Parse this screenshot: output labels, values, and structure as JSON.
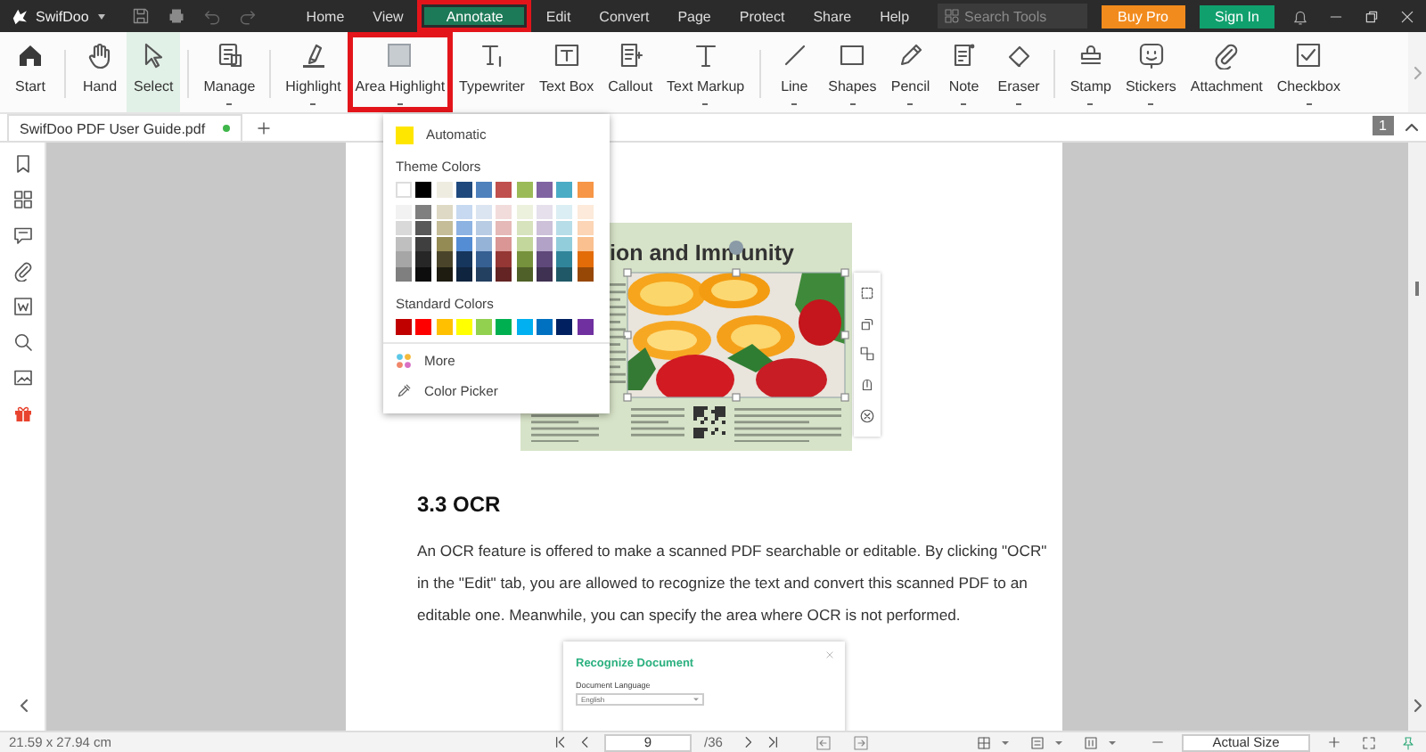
{
  "app": {
    "name": "SwifDoo"
  },
  "menu": [
    {
      "label": "Home",
      "selected": false,
      "marked": false
    },
    {
      "label": "View",
      "selected": false,
      "marked": false
    },
    {
      "label": "Annotate",
      "selected": true,
      "marked": true
    },
    {
      "label": "Edit",
      "selected": false,
      "marked": false
    },
    {
      "label": "Convert",
      "selected": false,
      "marked": false
    },
    {
      "label": "Page",
      "selected": false,
      "marked": false
    },
    {
      "label": "Protect",
      "selected": false,
      "marked": false
    },
    {
      "label": "Share",
      "selected": false,
      "marked": false
    },
    {
      "label": "Help",
      "selected": false,
      "marked": false
    }
  ],
  "search": {
    "placeholder": "Search Tools"
  },
  "account_buttons": [
    {
      "label": "Buy Pro",
      "kind": "purchase"
    },
    {
      "label": "Sign In",
      "kind": "sign_in"
    }
  ],
  "toolbar": {
    "tools": [
      {
        "label": "Start",
        "selected": false,
        "marked": false,
        "dropdown": false,
        "separator_before": false
      },
      {
        "label": "Hand",
        "selected": false,
        "marked": false,
        "dropdown": false,
        "separator_before": true
      },
      {
        "label": "Select",
        "selected": true,
        "marked": false,
        "dropdown": false,
        "separator_before": false
      },
      {
        "label": "Manage",
        "selected": false,
        "marked": false,
        "dropdown": true,
        "separator_before": true
      },
      {
        "label": "Highlight",
        "selected": false,
        "marked": false,
        "dropdown": true,
        "separator_before": true
      },
      {
        "label": "Area Highlight",
        "selected": false,
        "marked": true,
        "dropdown": true,
        "separator_before": false
      },
      {
        "label": "Typewriter",
        "selected": false,
        "marked": false,
        "dropdown": false,
        "separator_before": false
      },
      {
        "label": "Text Box",
        "selected": false,
        "marked": false,
        "dropdown": false,
        "separator_before": false
      },
      {
        "label": "Callout",
        "selected": false,
        "marked": false,
        "dropdown": false,
        "separator_before": false
      },
      {
        "label": "Text Markup",
        "selected": false,
        "marked": false,
        "dropdown": true,
        "separator_before": false
      },
      {
        "label": "Line",
        "selected": false,
        "marked": false,
        "dropdown": true,
        "separator_before": true
      },
      {
        "label": "Shapes",
        "selected": false,
        "marked": false,
        "dropdown": true,
        "separator_before": false
      },
      {
        "label": "Pencil",
        "selected": false,
        "marked": false,
        "dropdown": true,
        "separator_before": false
      },
      {
        "label": "Note",
        "selected": false,
        "marked": false,
        "dropdown": true,
        "separator_before": false
      },
      {
        "label": "Eraser",
        "selected": false,
        "marked": false,
        "dropdown": true,
        "separator_before": false
      },
      {
        "label": "Stamp",
        "selected": false,
        "marked": false,
        "dropdown": true,
        "separator_before": true
      },
      {
        "label": "Stickers",
        "selected": false,
        "marked": false,
        "dropdown": true,
        "separator_before": false
      },
      {
        "label": "Attachment",
        "selected": false,
        "marked": false,
        "dropdown": false,
        "separator_before": false
      },
      {
        "label": "Checkbox",
        "selected": false,
        "marked": false,
        "dropdown": true,
        "separator_before": false
      }
    ]
  },
  "document_tabs": [
    {
      "title": "SwifDoo PDF User Guide.pdf",
      "selected": true,
      "modified": true
    }
  ],
  "page_indicator": "1",
  "color_menu": {
    "automatic": {
      "label": "Automatic",
      "color": "#ffe600"
    },
    "theme_heading": "Theme Colors",
    "theme_colors": [
      {
        "color": "#ffffff",
        "shades": [
          {
            "color": "#f2f2f2"
          },
          {
            "color": "#d9d9d9"
          },
          {
            "color": "#bfbfbf"
          },
          {
            "color": "#a6a6a6"
          },
          {
            "color": "#7f7f7f"
          }
        ]
      },
      {
        "color": "#000000",
        "shades": [
          {
            "color": "#7f7f7f"
          },
          {
            "color": "#595959"
          },
          {
            "color": "#3f3f3f"
          },
          {
            "color": "#262626"
          },
          {
            "color": "#0d0d0d"
          }
        ]
      },
      {
        "color": "#eeece1",
        "shades": [
          {
            "color": "#ddd9c4"
          },
          {
            "color": "#c4bd97"
          },
          {
            "color": "#948a54"
          },
          {
            "color": "#4a452a"
          },
          {
            "color": "#1e1c11"
          }
        ]
      },
      {
        "color": "#1f497d",
        "shades": [
          {
            "color": "#c6d9f0"
          },
          {
            "color": "#8db3e2"
          },
          {
            "color": "#548dd4"
          },
          {
            "color": "#17365d"
          },
          {
            "color": "#0f243e"
          }
        ]
      },
      {
        "color": "#4f81bd",
        "shades": [
          {
            "color": "#dbe5f1"
          },
          {
            "color": "#b8cce4"
          },
          {
            "color": "#95b3d7"
          },
          {
            "color": "#366092"
          },
          {
            "color": "#244061"
          }
        ]
      },
      {
        "color": "#c0504d",
        "shades": [
          {
            "color": "#f2dcdb"
          },
          {
            "color": "#e5b9b7"
          },
          {
            "color": "#d99694"
          },
          {
            "color": "#953734"
          },
          {
            "color": "#632423"
          }
        ]
      },
      {
        "color": "#9bbb59",
        "shades": [
          {
            "color": "#ebf1dd"
          },
          {
            "color": "#d7e3bc"
          },
          {
            "color": "#c3d69b"
          },
          {
            "color": "#76923c"
          },
          {
            "color": "#4f6128"
          }
        ]
      },
      {
        "color": "#8064a2",
        "shades": [
          {
            "color": "#e5e0ec"
          },
          {
            "color": "#ccc1d9"
          },
          {
            "color": "#b2a2c7"
          },
          {
            "color": "#5f497a"
          },
          {
            "color": "#3f3151"
          }
        ]
      },
      {
        "color": "#4bacc6",
        "shades": [
          {
            "color": "#dbeef3"
          },
          {
            "color": "#b7dde8"
          },
          {
            "color": "#92cddc"
          },
          {
            "color": "#31859b"
          },
          {
            "color": "#205867"
          }
        ]
      },
      {
        "color": "#f79646",
        "shades": [
          {
            "color": "#fdeada"
          },
          {
            "color": "#fbd5b5"
          },
          {
            "color": "#fac08f"
          },
          {
            "color": "#e36c09"
          },
          {
            "color": "#974806"
          }
        ]
      }
    ],
    "standard_heading": "Standard Colors",
    "standard_colors": [
      {
        "color": "#c00000"
      },
      {
        "color": "#ff0000"
      },
      {
        "color": "#ffc000"
      },
      {
        "color": "#ffff00"
      },
      {
        "color": "#92d050"
      },
      {
        "color": "#00b050"
      },
      {
        "color": "#00b0f0"
      },
      {
        "color": "#0070c0"
      },
      {
        "color": "#002060"
      },
      {
        "color": "#7030a0"
      }
    ],
    "more": "More",
    "picker": "Color Picker"
  },
  "document": {
    "flyer_heading": "ion and Immunity",
    "section_heading": "3.3 OCR",
    "paragraph": "An OCR feature is offered to make a scanned PDF searchable or editable. By clicking \"OCR\" in the \"Edit\" tab, you are allowed to recognize the text and convert this scanned PDF to an editable one. Meanwhile, you can specify the area where OCR is not performed.",
    "dialog": {
      "title": "Recognize Document",
      "field_label": "Document Language",
      "field_value": "English"
    }
  },
  "status_bar": {
    "page_size": "21.59 x 27.94 cm",
    "page_number": "9",
    "page_count": "/36",
    "zoom": "Actual Size"
  }
}
